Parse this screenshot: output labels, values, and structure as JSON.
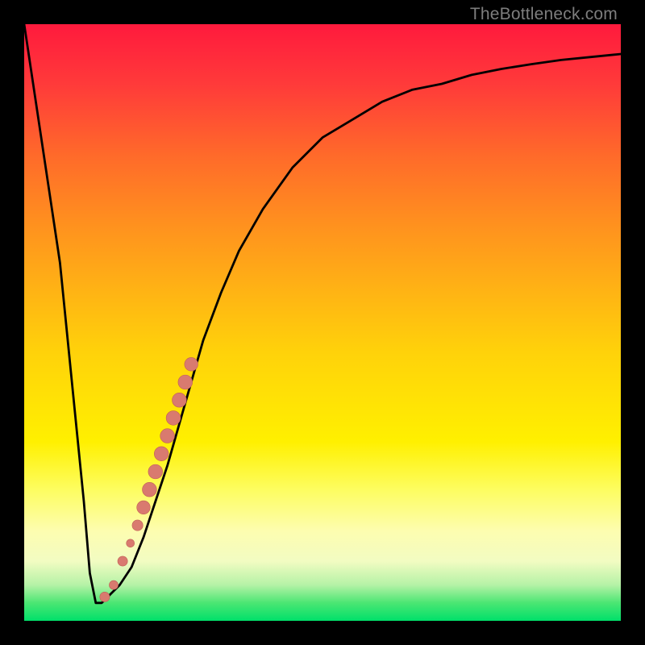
{
  "attribution": "TheBottleneck.com",
  "colors": {
    "curve_stroke": "#000000",
    "marker_fill": "#d97a6f",
    "marker_stroke": "#c06055",
    "frame": "#000000"
  },
  "chart_data": {
    "type": "line",
    "title": "",
    "xlabel": "",
    "ylabel": "",
    "xlim": [
      0,
      100
    ],
    "ylim": [
      0,
      100
    ],
    "note": "No explicit axis ticks or labels are rendered in the image; x is a normalized horizontal position and y is a normalized value (0 at bottom/green, 100 at top/red). Values are estimated from pixel positions.",
    "series": [
      {
        "name": "curve",
        "x": [
          0,
          3,
          6,
          8,
          10,
          11,
          12,
          13,
          14,
          16,
          18,
          20,
          22,
          24,
          26,
          28,
          30,
          33,
          36,
          40,
          45,
          50,
          55,
          60,
          65,
          70,
          75,
          80,
          85,
          90,
          95,
          100
        ],
        "y": [
          100,
          80,
          60,
          40,
          20,
          8,
          3,
          3,
          4,
          6,
          9,
          14,
          20,
          26,
          33,
          40,
          47,
          55,
          62,
          69,
          76,
          81,
          84,
          87,
          89,
          90,
          91.5,
          92.5,
          93.3,
          94,
          94.5,
          95
        ]
      }
    ],
    "markers": {
      "name": "highlighted-points",
      "note": "Salmon-colored markers lying on the rising branch of the curve.",
      "points": [
        {
          "x": 13.5,
          "y": 4,
          "r": 1.1
        },
        {
          "x": 15.0,
          "y": 6,
          "r": 1.0
        },
        {
          "x": 16.5,
          "y": 10,
          "r": 1.1
        },
        {
          "x": 17.8,
          "y": 13,
          "r": 0.9
        },
        {
          "x": 19.0,
          "y": 16,
          "r": 1.2
        },
        {
          "x": 20.0,
          "y": 19,
          "r": 1.5
        },
        {
          "x": 21.0,
          "y": 22,
          "r": 1.6
        },
        {
          "x": 22.0,
          "y": 25,
          "r": 1.6
        },
        {
          "x": 23.0,
          "y": 28,
          "r": 1.6
        },
        {
          "x": 24.0,
          "y": 31,
          "r": 1.6
        },
        {
          "x": 25.0,
          "y": 34,
          "r": 1.6
        },
        {
          "x": 26.0,
          "y": 37,
          "r": 1.6
        },
        {
          "x": 27.0,
          "y": 40,
          "r": 1.6
        },
        {
          "x": 28.0,
          "y": 43,
          "r": 1.5
        }
      ]
    }
  }
}
